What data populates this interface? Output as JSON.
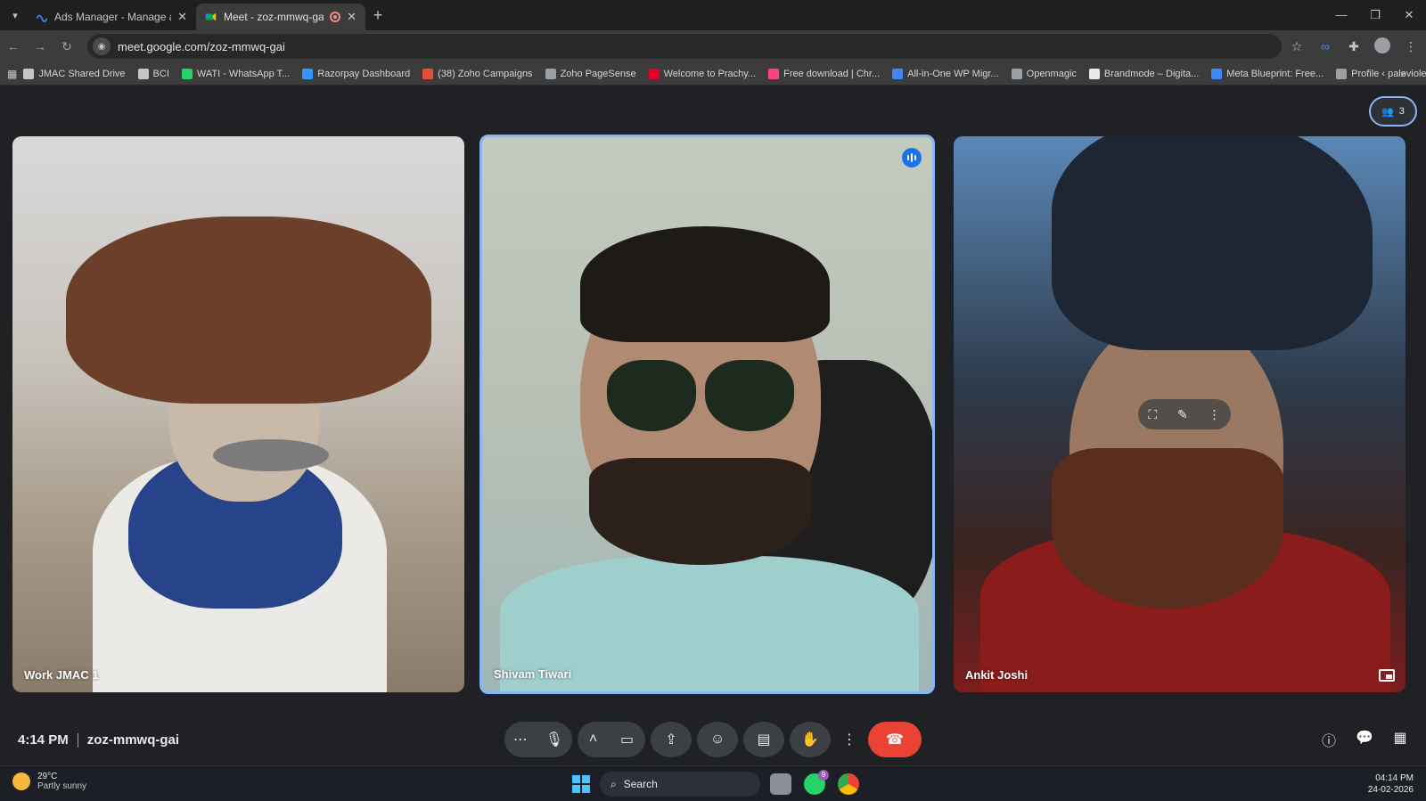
{
  "browser": {
    "tabs": [
      {
        "title": "Ads Manager - Manage ads - C",
        "active": false
      },
      {
        "title": "Meet - zoz-mmwq-gai",
        "active": true
      }
    ],
    "url": "meet.google.com/zoz-mmwq-gai",
    "bookmarks": [
      {
        "label": "JMAC Shared Drive",
        "icon": "folder-icon",
        "color": "#c4c7c5"
      },
      {
        "label": "BCI",
        "icon": "folder-icon",
        "color": "#c4c7c5"
      },
      {
        "label": "WATI - WhatsApp T...",
        "icon": "chat-icon",
        "color": "#25d366"
      },
      {
        "label": "Razorpay Dashboard",
        "icon": "razorpay-icon",
        "color": "#3395ff"
      },
      {
        "label": "(38) Zoho Campaigns",
        "icon": "zoho-icon",
        "color": "#e74c3c"
      },
      {
        "label": "Zoho PageSense",
        "icon": "zoho-icon",
        "color": "#9aa0a6"
      },
      {
        "label": "Welcome to Prachy...",
        "icon": "pinterest-icon",
        "color": "#e60023"
      },
      {
        "label": "Free download | Chr...",
        "icon": "drop-icon",
        "color": "#ff4081"
      },
      {
        "label": "All-in-One WP Migr...",
        "icon": "wp-icon",
        "color": "#4285f4"
      },
      {
        "label": "Openmagic",
        "icon": "gear-icon",
        "color": "#9aa0a6"
      },
      {
        "label": "Brandmode – Digita...",
        "icon": "brand-icon",
        "color": "#e8eaed"
      },
      {
        "label": "Meta Blueprint: Free...",
        "icon": "meta-icon",
        "color": "#4285f4"
      },
      {
        "label": "Profile ‹ palevioletre...",
        "icon": "wp-icon",
        "color": "#9aa0a6"
      }
    ]
  },
  "meet": {
    "participant_count": "3",
    "tiles": [
      {
        "name": "Work JMAC 1"
      },
      {
        "name": "Shivam Tiwari"
      },
      {
        "name": "Ankit Joshi"
      }
    ],
    "time": "4:14 PM",
    "meeting_code": "zoz-mmwq-gai"
  },
  "taskbar": {
    "temperature": "29°C",
    "weather": "Partly sunny",
    "search_label": "Search",
    "whatsapp_badge": "9",
    "clock_time": "04:14 PM",
    "clock_date": "24-02-2026"
  },
  "colors": {
    "accent": "#8ab4f8",
    "end_call": "#ea4335",
    "speaking": "#1a73e8"
  }
}
